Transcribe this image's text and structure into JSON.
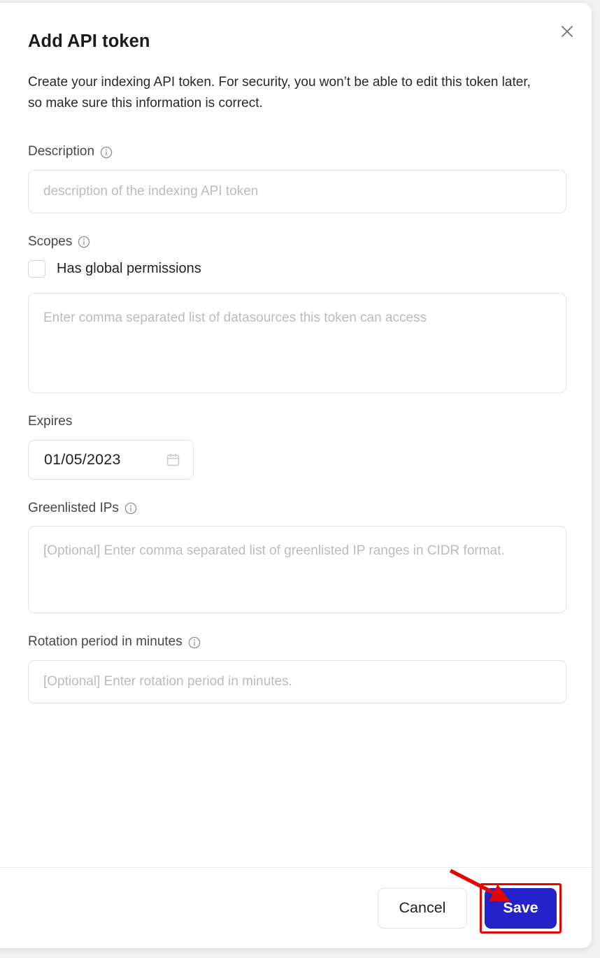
{
  "dialog": {
    "title": "Add API token",
    "description": "Create your indexing API token. For security, you won’t be able to edit this token later, so make sure this information is correct.",
    "close_icon": "close-icon"
  },
  "fields": {
    "description": {
      "label": "Description",
      "info_icon": "info-icon",
      "placeholder": "description of the indexing API token",
      "value": ""
    },
    "scopes": {
      "label": "Scopes",
      "info_icon": "info-icon",
      "checkbox_label": "Has global permissions",
      "checkbox_checked": "false",
      "placeholder": "Enter comma separated list of datasources this token can access",
      "value": ""
    },
    "expires": {
      "label": "Expires",
      "value": "01/05/2023",
      "calendar_icon": "calendar-icon"
    },
    "greenlisted_ips": {
      "label": "Greenlisted IPs",
      "info_icon": "info-icon",
      "placeholder": "[Optional] Enter comma separated list of greenlisted IP ranges in CIDR format.",
      "value": ""
    },
    "rotation_period": {
      "label": "Rotation period in minutes",
      "info_icon": "info-icon",
      "placeholder": "[Optional] Enter rotation period in minutes.",
      "value": ""
    }
  },
  "footer": {
    "cancel_label": "Cancel",
    "save_label": "Save"
  },
  "annotation": {
    "arrow_color": "#e10600",
    "highlight_color": "#e10600",
    "target": "save-button"
  },
  "colors": {
    "primary_button": "#2323c9",
    "dialog_background": "#ffffff",
    "page_background": "#f2f2f2",
    "border": "#e2e3e5",
    "placeholder_text": "#b9bbbf"
  }
}
